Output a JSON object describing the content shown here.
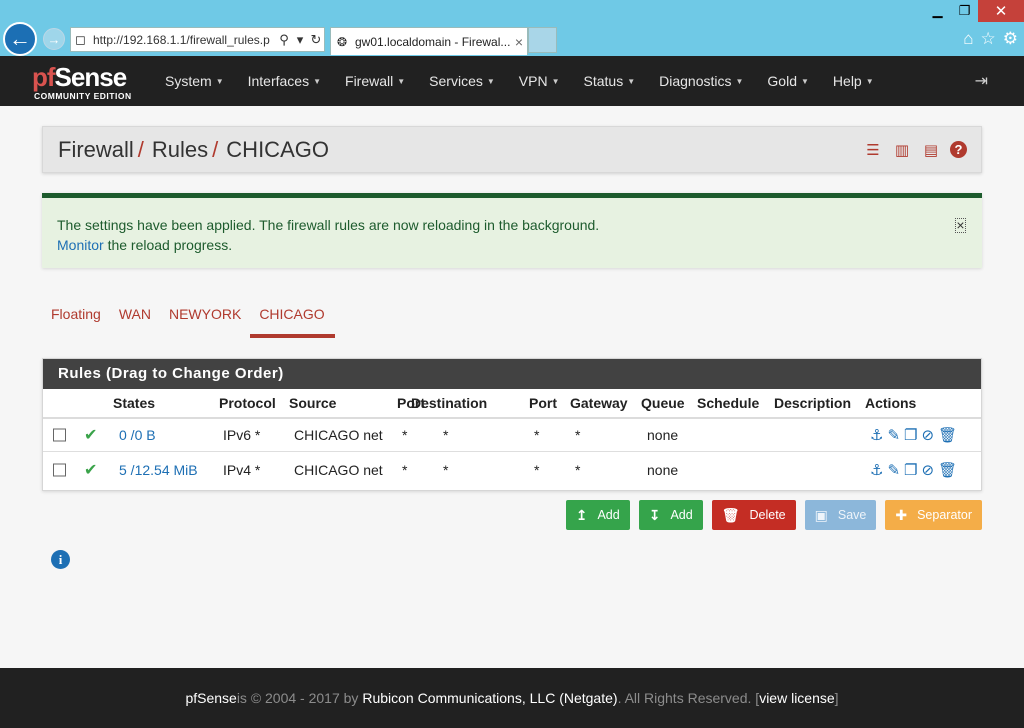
{
  "browser": {
    "url": "http://192.168.1.1/firewall_rules.p",
    "tab_title": "gw01.localdomain - Firewal...",
    "tab_close": "×",
    "win_min": "▁",
    "win_max": "❐",
    "win_close": "✕"
  },
  "brand": {
    "logo_text": "Sense",
    "logo_ring": "pf",
    "edition": "COMMUNITY EDITION"
  },
  "nav": {
    "items": [
      "System",
      "Interfaces",
      "Firewall",
      "Services",
      "VPN",
      "Status",
      "Diagnostics",
      "Gold",
      "Help"
    ]
  },
  "breadcrumb": {
    "level1": "Firewall",
    "level2": "Rules",
    "level3": "CHICAGO",
    "separator": "/"
  },
  "alert": {
    "message": "The settings have been applied. The firewall rules are now reloading in the background.",
    "link": "Monitor",
    "tail": " the reload progress.",
    "close": "×"
  },
  "tabs": [
    "Floating",
    "WAN",
    "NEWYORK",
    "CHICAGO"
  ],
  "panel": {
    "title": "Rules (Drag to Change Order)",
    "columns": {
      "states": "States",
      "protocol": "Protocol",
      "source": "Source",
      "port": "Port",
      "destination": "Destination",
      "dport": "Port",
      "gateway": "Gateway",
      "queue": "Queue",
      "schedule": "Schedule",
      "description": "Description",
      "actions": "Actions"
    },
    "rows": [
      {
        "states": "0 /0 B",
        "protocol": "IPv6 *",
        "source": "CHICAGO net",
        "port": "*",
        "destination": "*",
        "dport": "*",
        "gateway": "*",
        "queue": "none",
        "schedule": "",
        "description": ""
      },
      {
        "states": "5 /12.54 MiB",
        "protocol": "IPv4 *",
        "source": "CHICAGO net",
        "port": "*",
        "destination": "*",
        "dport": "*",
        "gateway": "*",
        "queue": "none",
        "schedule": "",
        "description": ""
      }
    ]
  },
  "buttons": {
    "add_top": "Add",
    "add_bottom": "Add",
    "delete": "Delete",
    "save": "Save",
    "separator": "Separator"
  },
  "footer": {
    "brand": "pfSense",
    "part1": " is © 2004 - 2017 by ",
    "company": "Rubicon Communications, LLC (Netgate)",
    "part2": ". All Rights Reserved. [",
    "license": "view license",
    "part3": "]"
  },
  "colors": {
    "accent": "#b03a2e",
    "link": "#1d6fb4",
    "success": "#35a44b",
    "danger": "#c42d24",
    "warning": "#f4ad48"
  }
}
